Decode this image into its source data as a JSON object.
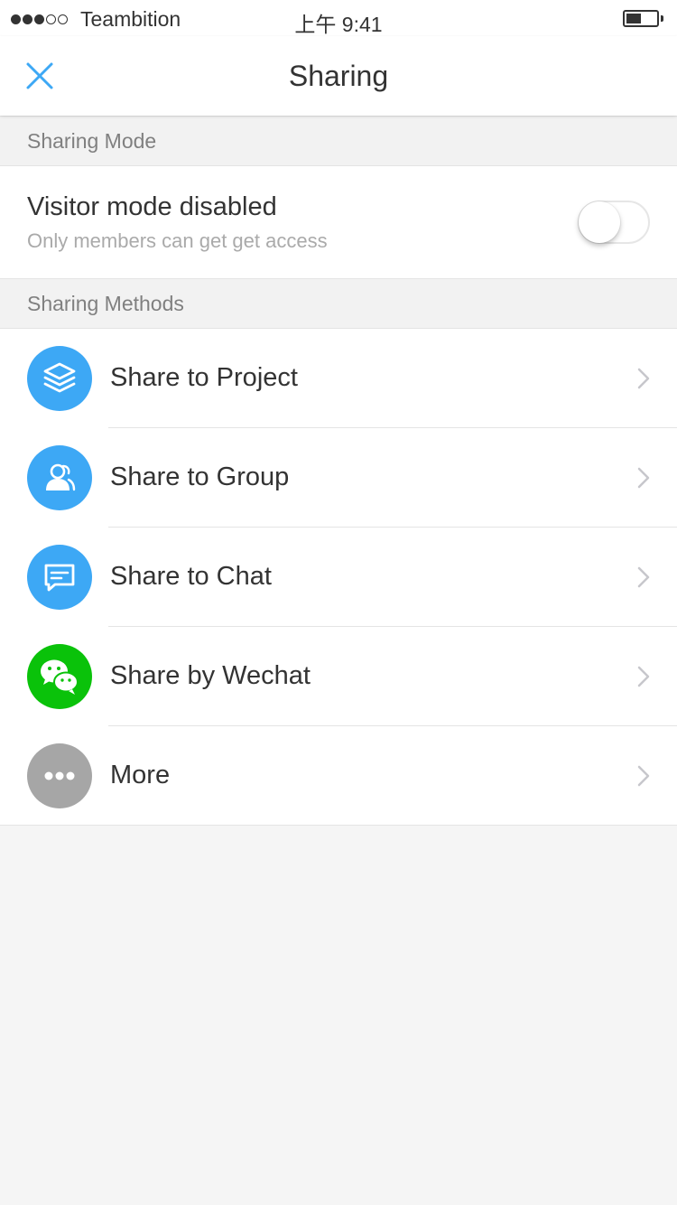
{
  "status_bar": {
    "carrier": "Teambition",
    "time": "上午 9:41",
    "signal_bars_filled": 3,
    "signal_bars_total": 5,
    "battery_level": 0.5
  },
  "nav": {
    "title": "Sharing",
    "close_icon": "close-icon"
  },
  "sections": {
    "sharing_mode": "Sharing Mode",
    "sharing_methods": "Sharing Methods"
  },
  "visitor_mode": {
    "title": "Visitor mode disabled",
    "subtitle": "Only members can get get access",
    "enabled": false
  },
  "methods": [
    {
      "label": "Share to Project",
      "icon": "layers-icon",
      "color": "#3da8f5"
    },
    {
      "label": "Share to Group",
      "icon": "group-icon",
      "color": "#3da8f5"
    },
    {
      "label": "Share to Chat",
      "icon": "chat-icon",
      "color": "#3da8f5"
    },
    {
      "label": "Share by Wechat",
      "icon": "wechat-icon",
      "color": "#0ac20a"
    },
    {
      "label": "More",
      "icon": "more-icon",
      "color": "#a6a6a6"
    }
  ],
  "colors": {
    "accent": "#3da8f5",
    "wechat": "#0ac20a",
    "more": "#a6a6a6",
    "background": "#f5f5f5"
  }
}
